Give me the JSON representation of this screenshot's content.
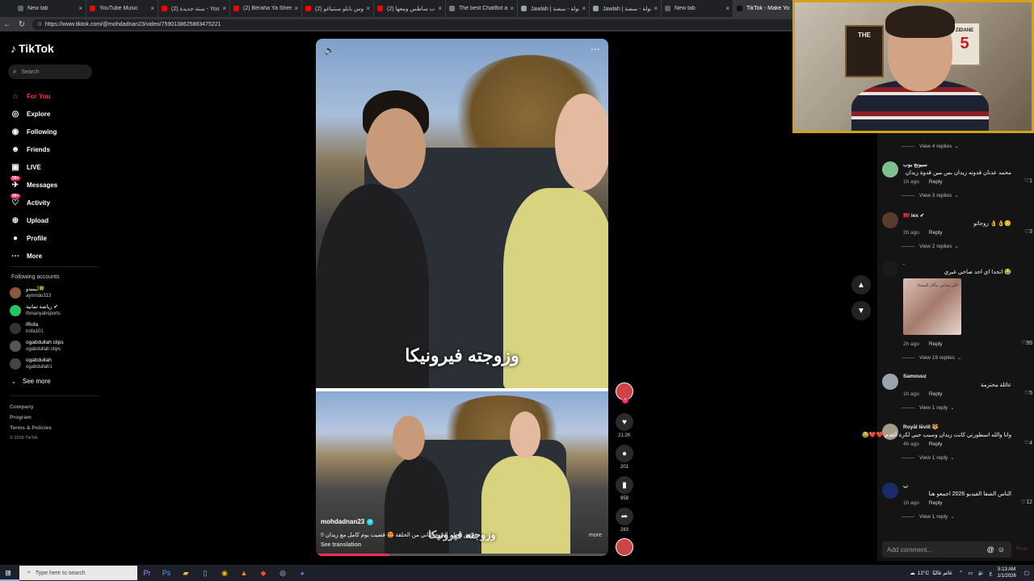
{
  "browser": {
    "tabs": [
      {
        "title": "New tab",
        "color": "#5f6368"
      },
      {
        "title": "YouTube Music",
        "color": "#ff0000"
      },
      {
        "title": "(2) سنة جديدة - YouTube",
        "color": "#ff0000"
      },
      {
        "title": "(2) Beraha Ya Sheekha",
        "color": "#ff0000"
      },
      {
        "title": "(2) عروس بابلو سنتياغو",
        "color": "#ff0000"
      },
      {
        "title": "(2) ولدت ساطس ومعها",
        "color": "#ff0000"
      },
      {
        "title": "The best ChatBot and",
        "color": "#7a7a7a"
      },
      {
        "title": "Jawlah | جولة - منصة",
        "color": "#9aa0a6"
      },
      {
        "title": "Jawlah | جولة - منصة",
        "color": "#9aa0a6"
      },
      {
        "title": "New tab",
        "color": "#5f6368"
      },
      {
        "title": "TikTok - Make Yo",
        "color": "#111111"
      }
    ],
    "url": "https://www.tiktok.com/@mohdadnan23/video/7590138625883475221"
  },
  "sidebar": {
    "logo": "TikTok",
    "search_placeholder": "Search",
    "menu": [
      {
        "label": "For You",
        "icon": "home-icon"
      },
      {
        "label": "Explore",
        "icon": "compass-icon"
      },
      {
        "label": "Following",
        "icon": "following-icon"
      },
      {
        "label": "Friends",
        "icon": "friends-icon"
      },
      {
        "label": "LIVE",
        "icon": "live-icon"
      },
      {
        "label": "Messages",
        "icon": "messages-icon",
        "badge": "99+"
      },
      {
        "label": "Activity",
        "icon": "activity-icon",
        "badge": "99+"
      },
      {
        "label": "Upload",
        "icon": "upload-icon"
      },
      {
        "label": "Profile",
        "icon": "profile-icon"
      },
      {
        "label": "More",
        "icon": "more-icon"
      }
    ],
    "following_title": "Following accounts",
    "accounts": [
      {
        "name": "أيمندو🍀",
        "handle": "aymndo313",
        "color": "#8a5a3a"
      },
      {
        "name": "رياضة ثمانية ✔",
        "handle": "thmanyahsports",
        "color": "#27c36b"
      },
      {
        "name": "lRofa",
        "handle": "irofa101",
        "color": "#333333"
      },
      {
        "name": "ogabdullah clips",
        "handle": "ogabdullah.clips",
        "color": "#555555"
      },
      {
        "name": "ogabdullah",
        "handle": "ogabdullah1",
        "color": "#444444"
      }
    ],
    "see_more": "See more",
    "footer": [
      "Company",
      "Program",
      "Terms & Policies"
    ],
    "copyright": "© 2026 TikTok"
  },
  "video": {
    "caption_top": "وزوجته فيرونيكا",
    "caption_bottom": "وزوجته فيرونيكا",
    "author": "mohdadnan23",
    "description": "تحقق الحلم الجزء الثاني من الحلقة 😍 قضيت يوم كامل مع زيدان !!",
    "more": "more",
    "see_translation": "See translation",
    "progress": 0.25
  },
  "actions": {
    "likes": "21.2K",
    "comments": "201",
    "saves": "958",
    "shares": "283"
  },
  "comments": [
    {
      "name": "سبونج بوب",
      "text": "محمد عدنان قدوته زيدان بس مين قدوة زيدان",
      "time": "1h ago",
      "likes": "1",
      "replies": "View 3 replies",
      "color": "#7fbf8f"
    },
    {
      "name": "🇲🇦 lex ✔",
      "text": "😊👌👌 زوجاتو",
      "time": "2h ago",
      "likes": "3",
      "replies": "View 2 replies",
      "color": "#5a3a2a"
    },
    {
      "name": ".",
      "text": "😂 اتحدا اي احد صاحي غيري",
      "time": "2h ago",
      "likes": "99",
      "replies": "View 19 replies",
      "color": "#1a1a1a",
      "gif": "اللي صاحي بيأكل السماء"
    },
    {
      "name": "Samouuz",
      "text": "عائلة محترمة",
      "time": "1h ago",
      "likes": "5",
      "replies": "View 1 reply",
      "color": "#9aa3b0"
    },
    {
      "name": "Royāl lēvill 🐯",
      "text": "وانا والله اسطورتي كانت زيدان وسبب حبي لكرة القدم ❤️❤️😂",
      "time": "4h ago",
      "likes": "4",
      "replies": "View 1 reply",
      "color": "#a89a88"
    },
    {
      "name": "ب",
      "text": "الناس الشفا الفيديو 2026 اجمعو هنا",
      "time": "1h ago",
      "likes": "12",
      "replies": "View 1 reply",
      "color": "#1a2a6a"
    }
  ],
  "top_replies": "View 4 replies",
  "reply_label": "Reply",
  "add_comment_placeholder": "Add comment...",
  "post_label": "Post",
  "webcam": {
    "poster_left": "THE",
    "poster_right": "ZIDANE",
    "poster_number": "5"
  },
  "taskbar": {
    "search_placeholder": "Type here to search",
    "weather": "12°C",
    "weather_text": "غائم غالبًا",
    "time": "5:13 AM",
    "date": "1/1/2026"
  }
}
